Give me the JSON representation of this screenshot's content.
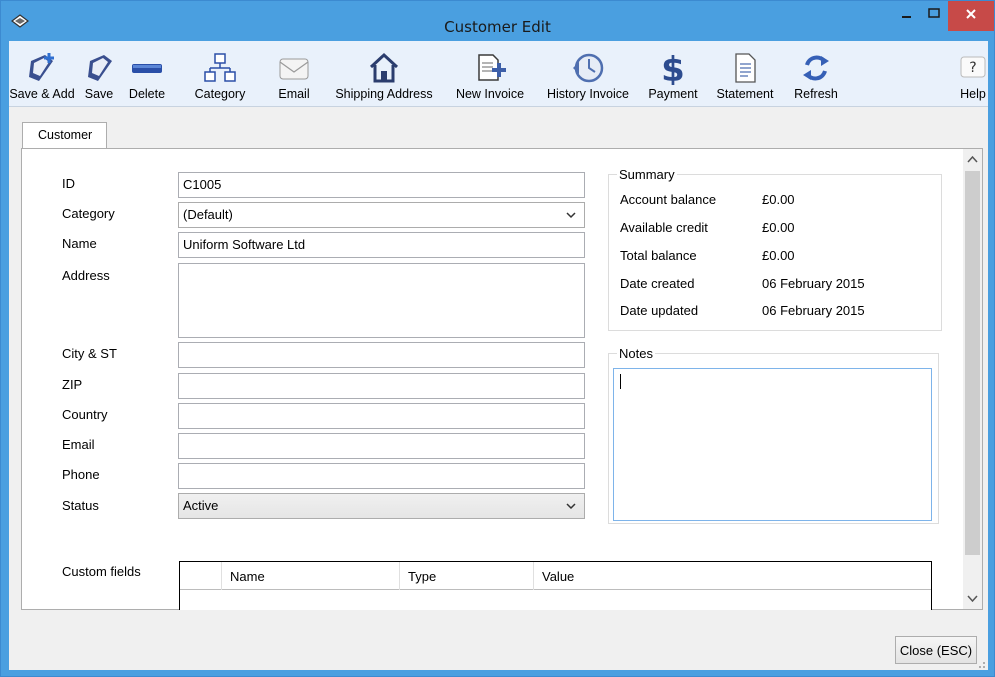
{
  "window": {
    "title": "Customer Edit",
    "controls": {
      "minimize_icon": "minimize-icon",
      "maximize_icon": "maximize-icon",
      "close_icon": "close-icon"
    }
  },
  "toolbar": {
    "buttons": [
      {
        "label": "Save & Add",
        "icon": "save-add-icon"
      },
      {
        "label": "Save",
        "icon": "save-icon"
      },
      {
        "label": "Delete",
        "icon": "delete-icon"
      },
      {
        "label": "Category",
        "icon": "category-icon"
      },
      {
        "label": "Email",
        "icon": "email-icon"
      },
      {
        "label": "Shipping Address",
        "icon": "house-icon"
      },
      {
        "label": "New Invoice",
        "icon": "new-invoice-icon"
      },
      {
        "label": "History Invoice",
        "icon": "history-icon"
      },
      {
        "label": "Payment",
        "icon": "dollar-icon"
      },
      {
        "label": "Statement",
        "icon": "statement-icon"
      },
      {
        "label": "Refresh",
        "icon": "refresh-icon"
      },
      {
        "label": "Help",
        "icon": "help-icon"
      }
    ]
  },
  "tabs": [
    {
      "label": "Customer",
      "active": true
    }
  ],
  "form": {
    "id": {
      "label": "ID",
      "value": "C1005"
    },
    "category": {
      "label": "Category",
      "value": "(Default)"
    },
    "name": {
      "label": "Name",
      "value": "Uniform Software Ltd"
    },
    "address": {
      "label": "Address",
      "value": ""
    },
    "city_st": {
      "label": "City & ST",
      "value": ""
    },
    "zip": {
      "label": "ZIP",
      "value": ""
    },
    "country": {
      "label": "Country",
      "value": ""
    },
    "email": {
      "label": "Email",
      "value": ""
    },
    "phone": {
      "label": "Phone",
      "value": ""
    },
    "status": {
      "label": "Status",
      "value": "Active"
    }
  },
  "summary": {
    "title": "Summary",
    "rows": [
      {
        "label": "Account balance",
        "value": "£0.00"
      },
      {
        "label": "Available credit",
        "value": "£0.00"
      },
      {
        "label": "Total balance",
        "value": "£0.00"
      },
      {
        "label": "Date created",
        "value": "06 February 2015"
      },
      {
        "label": "Date updated",
        "value": "06 February 2015"
      }
    ]
  },
  "notes": {
    "title": "Notes",
    "value": ""
  },
  "custom_fields": {
    "label": "Custom fields",
    "columns": [
      "",
      "Name",
      "Type",
      "Value"
    ]
  },
  "footer": {
    "close_label": "Close (ESC)"
  },
  "colors": {
    "titlebar": "#4a9fe0",
    "close_button": "#c74a48",
    "toolbar": "#e9f1fb"
  }
}
